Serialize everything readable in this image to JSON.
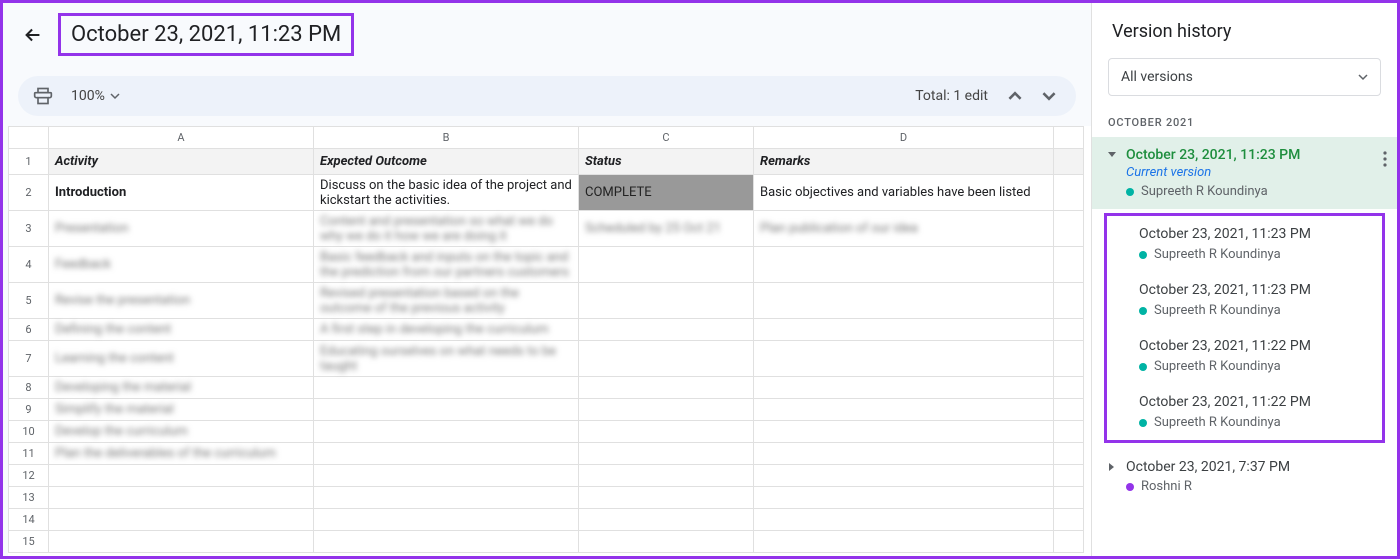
{
  "header": {
    "title": "October 23, 2021, 11:23 PM",
    "zoom": "100%",
    "total_edits": "Total: 1 edit"
  },
  "columns": [
    "A",
    "B",
    "C",
    "D"
  ],
  "sheet": {
    "headers": {
      "activity": "Activity",
      "expected": "Expected Outcome",
      "status": "Status",
      "remarks": "Remarks"
    },
    "rows": [
      {
        "activity": "Introduction",
        "expected": "Discuss on the basic idea of the project and kickstart the activities.",
        "status": "COMPLETE",
        "remarks": "Basic objectives and variables have been listed"
      }
    ],
    "blur_rows": [
      {
        "a": "Presentation",
        "b": "Content and presentation so what we do why we do it how we are doing it",
        "c": "Scheduled by 25 Oct 21",
        "d": "Plan publication of our idea"
      },
      {
        "a": "Feedback",
        "b": "Basic feedback and inputs on the topic and the prediction from our partners customers",
        "c": "",
        "d": ""
      },
      {
        "a": "Revise the presentation",
        "b": "Revised presentation based on the outcome of the previous activity",
        "c": "",
        "d": ""
      },
      {
        "a": "Defining the content",
        "b": "A first step in developing the curriculum",
        "c": "",
        "d": ""
      },
      {
        "a": "Learning the content",
        "b": "Educating ourselves on what needs to be taught",
        "c": "",
        "d": ""
      },
      {
        "a": "Developing the material",
        "b": "",
        "c": "",
        "d": ""
      },
      {
        "a": "Simplify the material",
        "b": "",
        "c": "",
        "d": ""
      },
      {
        "a": "Develop the curriculum",
        "b": "",
        "c": "",
        "d": ""
      },
      {
        "a": "Plan the deliverables of the curriculum",
        "b": "",
        "c": "",
        "d": ""
      }
    ]
  },
  "side": {
    "title": "Version history",
    "filter": "All versions",
    "month": "OCTOBER 2021",
    "current": {
      "date": "October 23, 2021, 11:23 PM",
      "label": "Current version",
      "editor": "Supreeth R Koundinya",
      "color": "#00b3a4"
    },
    "sub_versions": [
      {
        "date": "October 23, 2021, 11:23 PM",
        "editor": "Supreeth R Koundinya",
        "color": "#00b3a4"
      },
      {
        "date": "October 23, 2021, 11:23 PM",
        "editor": "Supreeth R Koundinya",
        "color": "#00b3a4"
      },
      {
        "date": "October 23, 2021, 11:22 PM",
        "editor": "Supreeth R Koundinya",
        "color": "#00b3a4"
      },
      {
        "date": "October 23, 2021, 11:22 PM",
        "editor": "Supreeth R Koundinya",
        "color": "#00b3a4"
      }
    ],
    "other": {
      "date": "October 23, 2021, 7:37 PM",
      "editor": "Roshni R",
      "color": "#9334e9"
    }
  }
}
